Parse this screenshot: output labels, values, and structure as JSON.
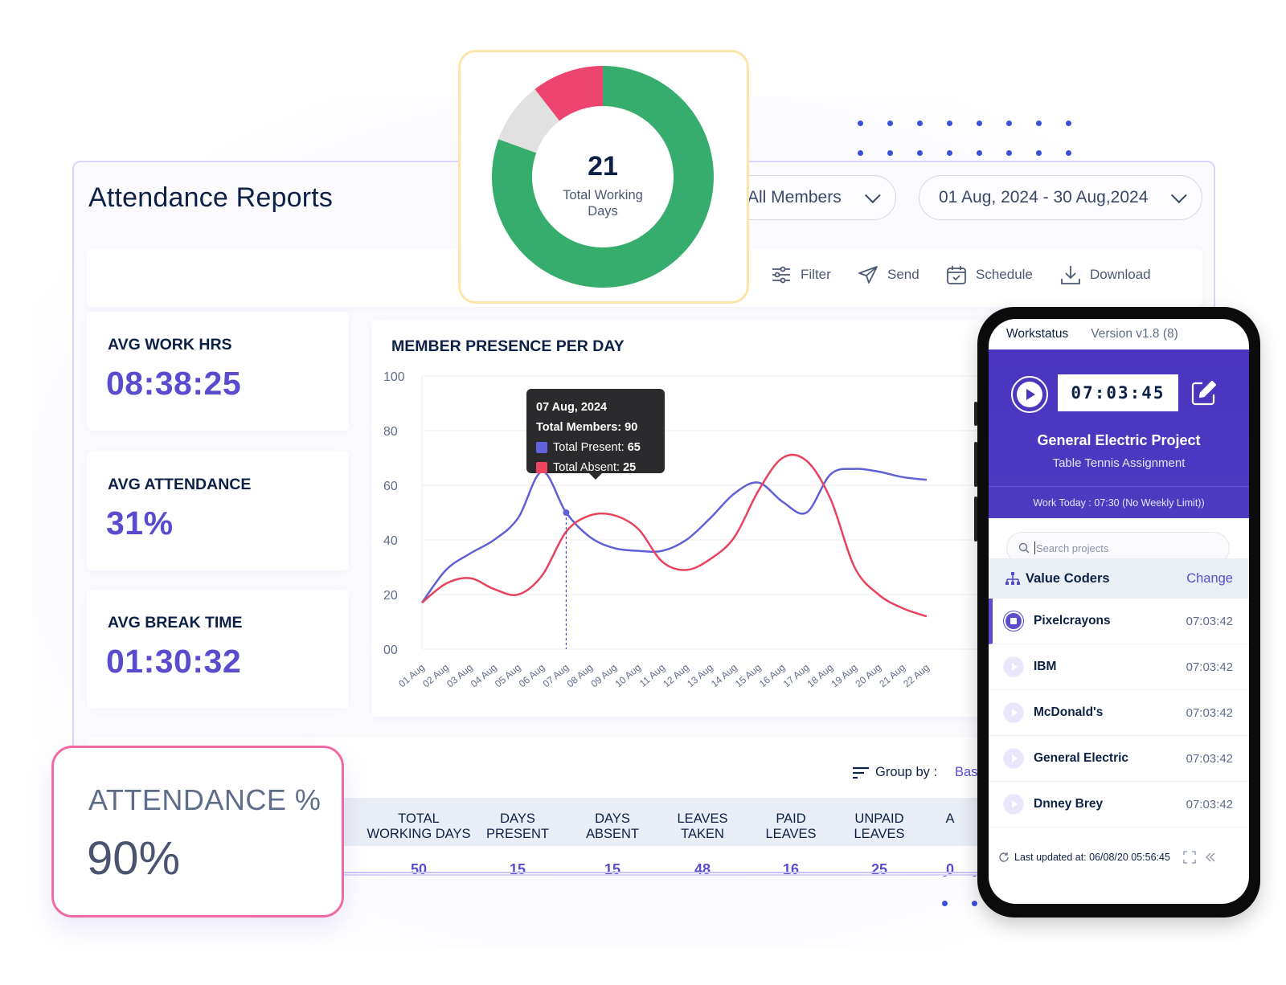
{
  "page": {
    "title": "Attendance Reports",
    "members_select": "All Members",
    "date_range_select": "01 Aug, 2024 - 30 Aug,2024"
  },
  "toolbar": {
    "filter": "Filter",
    "send": "Send",
    "schedule": "Schedule",
    "download": "Download"
  },
  "stats": [
    {
      "label": "AVG WORK HRS",
      "value": "08:38:25"
    },
    {
      "label": "AVG ATTENDANCE",
      "value": "31%"
    },
    {
      "label": "AVG BREAK TIME",
      "value": "01:30:32"
    }
  ],
  "donut": {
    "number": "21",
    "label_line1": "Total Working",
    "label_line2": "Days",
    "segments": [
      {
        "name": "Present",
        "fraction": 0.805,
        "color": "#37ad6d"
      },
      {
        "name": "Other",
        "fraction": 0.09,
        "color": "#e1e1e1"
      },
      {
        "name": "Absent",
        "fraction": 0.105,
        "color": "#ee4570"
      }
    ]
  },
  "tooltip": {
    "date": "07 Aug, 2024",
    "members_label": "Total Members:",
    "members_value": "90",
    "present_label": "Total Present:",
    "present_value": "65",
    "absent_label": "Total Absent:",
    "absent_value": "25"
  },
  "chart_data": {
    "type": "line",
    "title": "MEMBER PRESENCE PER DAY",
    "xlabel": "",
    "ylabel": "",
    "ylim": [
      0,
      100
    ],
    "yticks": [
      "00",
      "20",
      "40",
      "60",
      "80",
      "100"
    ],
    "grid": true,
    "categories": [
      "01 Aug",
      "02 Aug",
      "03 Aug",
      "04 Aug",
      "05 Aug",
      "06 Aug",
      "07 Aug",
      "08 Aug",
      "09 Aug",
      "10 Aug",
      "11 Aug",
      "12 Aug",
      "13 Aug",
      "14 Aug",
      "15 Aug",
      "16 Aug",
      "17 Aug",
      "18 Aug",
      "19 Aug",
      "20 Aug",
      "21 Aug",
      "22 Aug"
    ],
    "series": [
      {
        "name": "Total Present",
        "color": "#5f5fd6",
        "values": [
          17,
          29,
          35,
          40,
          48,
          65,
          50,
          41,
          37,
          36,
          36,
          40,
          48,
          57,
          61,
          54,
          50,
          64,
          66,
          65,
          63,
          62
        ]
      },
      {
        "name": "Total Absent",
        "color": "#e8435d",
        "values": [
          17,
          24,
          26,
          22,
          20,
          27,
          43,
          49,
          49,
          44,
          32,
          29,
          33,
          41,
          58,
          70,
          69,
          55,
          30,
          20,
          15,
          12
        ]
      }
    ],
    "visible_points": 21,
    "highlight_index": 6
  },
  "table": {
    "group_by_label": "Group by :",
    "group_by_value": "Bas",
    "headers": [
      {
        "line1": "TOTAL",
        "line2": "WORKING DAYS"
      },
      {
        "line1": "DAYS",
        "line2": "PRESENT"
      },
      {
        "line1": "DAYS",
        "line2": "ABSENT"
      },
      {
        "line1": "LEAVES",
        "line2": "TAKEN"
      },
      {
        "line1": "PAID",
        "line2": "LEAVES"
      },
      {
        "line1": "UNPAID",
        "line2": "LEAVES"
      },
      {
        "line1": "A",
        "line2": ""
      }
    ],
    "row": [
      "50",
      "15",
      "15",
      "48",
      "16",
      "25",
      "0"
    ]
  },
  "attendance_card": {
    "label": "ATTENDANCE %",
    "value": "90%"
  },
  "phone": {
    "app_name": "Workstatus",
    "version": "Version v1.8 (8)",
    "timer": "07:03:45",
    "project": "General Electric Project",
    "task": "Table Tennis Assignment",
    "work_today": "Work Today : 07:30 (No Weekly Limit))",
    "search_placeholder": "Search projects",
    "org_name": "Value Coders",
    "org_change": "Change",
    "projects": [
      {
        "name": "Pixelcrayons",
        "time": "07:03:42",
        "state": "running"
      },
      {
        "name": "IBM",
        "time": "07:03:42",
        "state": "stopped"
      },
      {
        "name": "McDonald's",
        "time": "07:03:42",
        "state": "stopped"
      },
      {
        "name": "General Electric",
        "time": "07:03:42",
        "state": "stopped"
      },
      {
        "name": "Dnney Brey",
        "time": "07:03:42",
        "state": "stopped"
      }
    ],
    "last_updated": "Last updated at: 06/08/20  05:56:45"
  }
}
